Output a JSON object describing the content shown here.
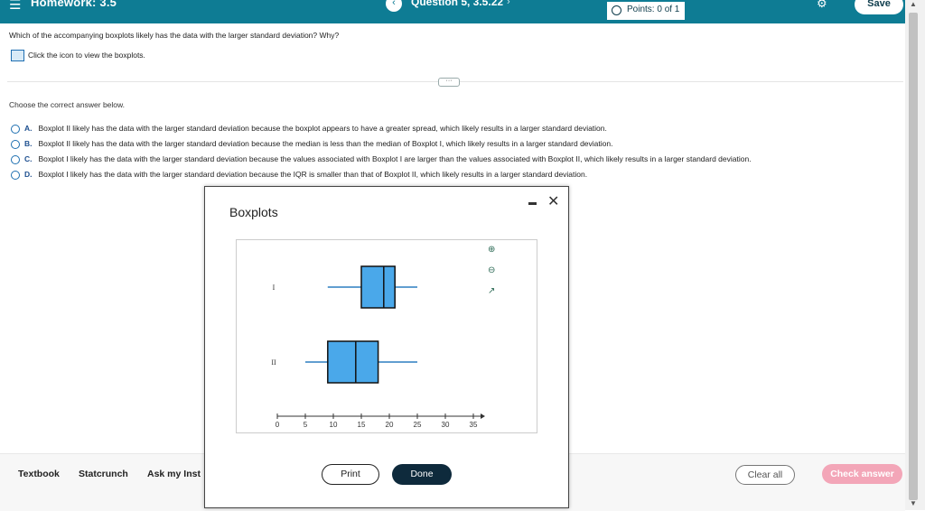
{
  "header": {
    "menu_icon": "hamburger-icon",
    "homework_title": "Homework: 3.5",
    "question_label": "Question 5, 3.5.22",
    "points_label": "Points: 0 of 1",
    "save_label": "Save",
    "accent": "#0e7c94"
  },
  "question": {
    "text": "Which of the accompanying boxplots likely has the data with the larger standard deviation? Why?",
    "image_link": "Click the icon to view the boxplots.",
    "choose_prompt": "Choose the correct answer below.",
    "options": [
      {
        "letter": "A.",
        "text": "Boxplot II likely has the data with the larger standard deviation because the boxplot appears to have a greater spread, which likely results in a larger standard deviation."
      },
      {
        "letter": "B.",
        "text": "Boxplot II likely has the data with the larger standard deviation because the median is less than the median of Boxplot I, which likely results in a larger standard deviation."
      },
      {
        "letter": "C.",
        "text": "Boxplot I likely has the data with the larger standard deviation because the values associated with Boxplot I are larger than the values associated with Boxplot II, which likely results in a larger standard deviation."
      },
      {
        "letter": "D.",
        "text": "Boxplot I likely has the data with the larger standard deviation because the IQR is smaller than that of Boxplot II, which likely results in a larger standard deviation."
      }
    ]
  },
  "modal": {
    "title": "Boxplots",
    "print_label": "Print",
    "done_label": "Done"
  },
  "footer": {
    "textbook": "Textbook",
    "statcrunch": "Statcrunch",
    "ask": "Ask my Inst",
    "clear_all": "Clear all",
    "check_answer": "Check answer"
  },
  "chart_data": {
    "type": "boxplot",
    "x_range": [
      0,
      35
    ],
    "x_ticks": [
      0,
      5,
      10,
      15,
      20,
      25,
      30,
      35
    ],
    "box_color": "#4aa8ea",
    "whisker_color": "#2d7fc1",
    "boxes": [
      {
        "label": "I",
        "min": 9,
        "q1": 15,
        "median": 19,
        "q3": 21,
        "max": 25
      },
      {
        "label": "II",
        "min": 5,
        "q1": 9,
        "median": 14,
        "q3": 18,
        "max": 25
      }
    ]
  }
}
